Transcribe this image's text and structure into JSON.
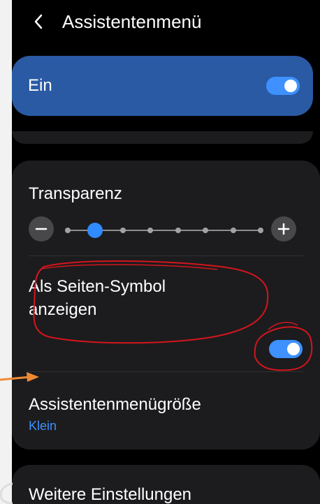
{
  "header": {
    "title": "Assistentenmenü",
    "back_icon": "chevron-left-icon"
  },
  "master_toggle": {
    "label": "Ein",
    "checked": true
  },
  "settings": {
    "transparency": {
      "label": "Transparenz",
      "minus_label": "−",
      "plus_label": "+",
      "step_count": 8,
      "selected_step": 2
    },
    "side_symbol": {
      "label": "Als Seiten-Symbol anzeigen",
      "checked": true
    },
    "menu_size": {
      "label": "Assistentenmenügröße",
      "value": "Klein"
    }
  },
  "more_settings": {
    "label": "Weitere Einstellungen"
  },
  "colors": {
    "background": "#000000",
    "card": "#1c1c1e",
    "primary_card": "#2a5aa3",
    "accent": "#3e91ff",
    "text": "#ffffff",
    "annotation_red": "#d4151d",
    "annotation_orange": "#f08a32"
  },
  "annotations": {
    "red_outline": "red hand-drawn outline around side-symbol setting",
    "orange_arrow": "orange arrow pointing to menu size setting"
  }
}
